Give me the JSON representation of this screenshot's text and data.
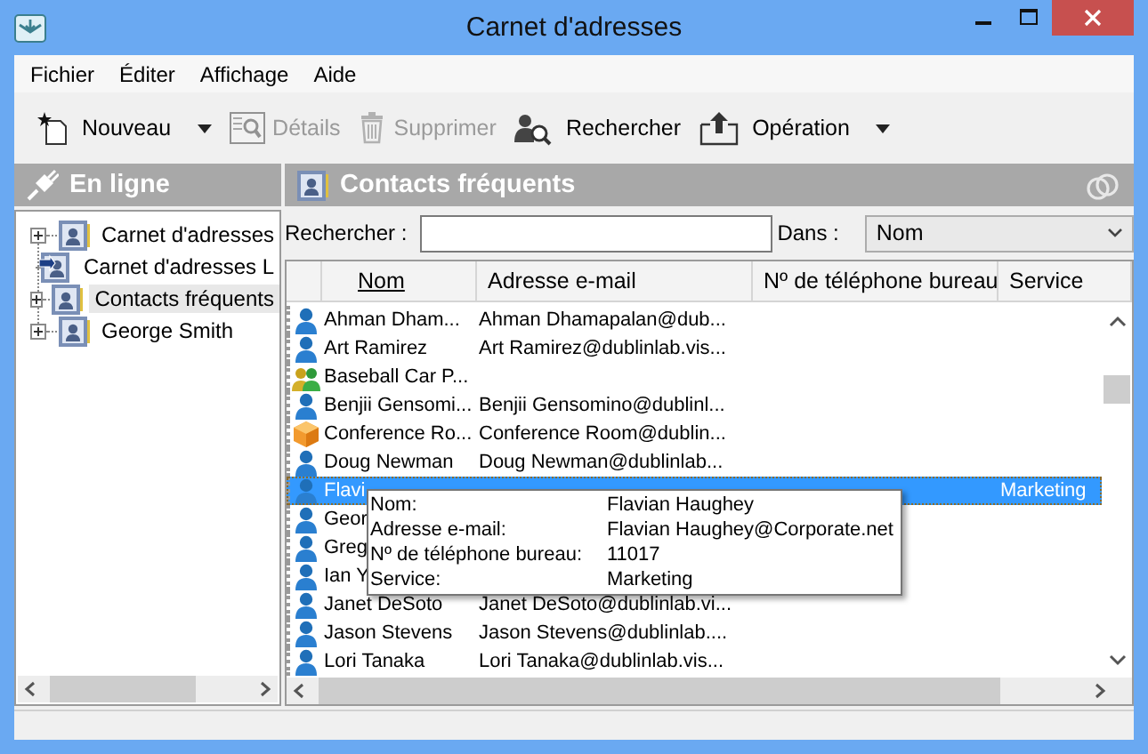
{
  "window": {
    "title": "Carnet d'adresses"
  },
  "menu": [
    "Fichier",
    "Éditer",
    "Affichage",
    "Aide"
  ],
  "toolbar": [
    {
      "label": "Nouveau",
      "kind": "new",
      "disabled": false,
      "dropdown": true
    },
    {
      "label": "Détails",
      "kind": "details",
      "disabled": true,
      "dropdown": false
    },
    {
      "label": "Supprimer",
      "kind": "delete",
      "disabled": true,
      "dropdown": false
    },
    {
      "label": "Rechercher",
      "kind": "search",
      "disabled": false,
      "dropdown": false
    },
    {
      "label": "Opération",
      "kind": "operation",
      "disabled": false,
      "dropdown": true
    }
  ],
  "sidebar": {
    "title": "En ligne",
    "items": [
      {
        "label": "Carnet d'adresses",
        "kind": "book",
        "has_children": true,
        "selected": false
      },
      {
        "label": "Carnet d'adresses L",
        "kind": "linked-book",
        "has_children": false,
        "selected": false
      },
      {
        "label": "Contacts fréquents",
        "kind": "book",
        "has_children": true,
        "selected": true
      },
      {
        "label": "George Smith",
        "kind": "book",
        "has_children": true,
        "selected": false
      }
    ]
  },
  "contacts": {
    "title": "Contacts fréquents",
    "search_label": "Rechercher :",
    "scope_label": "Dans :",
    "scope_value": "Nom",
    "columns": [
      {
        "label": "Nom",
        "sorted": true
      },
      {
        "label": "Adresse e-mail",
        "sorted": false
      },
      {
        "label": "Nº de téléphone bureau",
        "sorted": false
      },
      {
        "label": "Service",
        "sorted": false
      }
    ],
    "rows": [
      {
        "kind": "person",
        "selected": false,
        "name": "Ahman Dham...",
        "email": "Ahman Dhamapalan@dub...",
        "phone": "",
        "service": ""
      },
      {
        "kind": "person",
        "selected": false,
        "name": "Art Ramirez",
        "email": "Art Ramirez@dublinlab.vis...",
        "phone": "",
        "service": ""
      },
      {
        "kind": "group",
        "selected": false,
        "name": "Baseball Car P...",
        "email": "",
        "phone": "",
        "service": ""
      },
      {
        "kind": "person",
        "selected": false,
        "name": "Benjii Gensomi...",
        "email": "Benjii Gensomino@dublinl...",
        "phone": "",
        "service": ""
      },
      {
        "kind": "room",
        "selected": false,
        "name": "Conference Ro...",
        "email": "Conference Room@dublin...",
        "phone": "",
        "service": ""
      },
      {
        "kind": "person",
        "selected": false,
        "name": "Doug Newman",
        "email": "Doug Newman@dublinlab...",
        "phone": "",
        "service": ""
      },
      {
        "kind": "person",
        "selected": true,
        "name": "Flavi",
        "email": "",
        "phone": "",
        "service": "Marketing"
      },
      {
        "kind": "person",
        "selected": false,
        "name": "Geor",
        "email": "",
        "phone": "",
        "service": ""
      },
      {
        "kind": "person",
        "selected": false,
        "name": "Greg",
        "email": "",
        "phone": "",
        "service": ""
      },
      {
        "kind": "person",
        "selected": false,
        "name": "Ian Y",
        "email": "",
        "phone": "",
        "service": ""
      },
      {
        "kind": "person",
        "selected": false,
        "name": "Janet DeSoto",
        "email": "Janet DeSoto@dublinlab.vi...",
        "phone": "",
        "service": ""
      },
      {
        "kind": "person",
        "selected": false,
        "name": "Jason Stevens",
        "email": "Jason Stevens@dublinlab....",
        "phone": "",
        "service": ""
      },
      {
        "kind": "person",
        "selected": false,
        "name": "Lori Tanaka",
        "email": "Lori Tanaka@dublinlab.vis...",
        "phone": "",
        "service": ""
      }
    ],
    "tooltip": [
      {
        "label": "Nom:",
        "value": "Flavian Haughey"
      },
      {
        "label": "Adresse e-mail:",
        "value": "Flavian Haughey@Corporate.net"
      },
      {
        "label": "Nº de téléphone bureau:",
        "value": "11017"
      },
      {
        "label": "Service:",
        "value": "Marketing"
      }
    ]
  }
}
